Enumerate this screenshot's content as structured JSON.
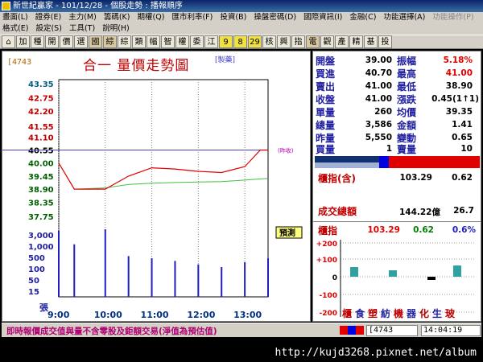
{
  "window": {
    "title": "新世紀贏家 - 101/12/28 - 個股走勢 : 播報順序"
  },
  "menu": {
    "row1": [
      "畫面(L)",
      "證券(E)",
      "主力(M)",
      "籌碼(K)",
      "期權(Q)",
      "匯市利率(F)",
      "投資(B)",
      "操盤密碼(D)",
      "國際資訊(I)",
      "金融(C)",
      "功能選擇(A)",
      "功能操作(P)"
    ],
    "row2": [
      "格式(E)",
      "設定(S)",
      "工具(T)",
      "說明(H)"
    ]
  },
  "toolbar": {
    "buttons": [
      "⌂",
      "加",
      "種",
      "開",
      "價",
      "選",
      "國",
      "綜",
      "綜",
      "類",
      "幅",
      "智",
      "權",
      "委",
      "江",
      "9",
      "8",
      "29",
      "核",
      "興",
      "指",
      "電",
      "觀",
      "產",
      "精",
      "基",
      "投"
    ]
  },
  "chart": {
    "stock_code": "[4743",
    "title": "合一  量價走勢圖",
    "industry": "[製藥]",
    "reference_label": "(昨收)",
    "volume_unit": "張",
    "price_axis_labels": [
      "43.35",
      "42.75",
      "42.20",
      "41.55",
      "41.10",
      "40.55",
      "40.00",
      "39.45",
      "38.90",
      "38.35",
      "37.75"
    ],
    "volume_axis_labels": [
      "3,000",
      "1,000",
      "500",
      "100",
      "50",
      "15"
    ],
    "time_labels": [
      "9:00",
      "10:00",
      "11:00",
      "12:00",
      "13:00"
    ],
    "trial_label": "預測"
  },
  "chart_data": {
    "type": "line",
    "title": "合一  量價走勢圖",
    "xlabel": "",
    "ylabel": "",
    "x": [
      "9:00",
      "9:20",
      "10:00",
      "10:30",
      "11:00",
      "11:30",
      "12:00",
      "12:30",
      "13:00",
      "13:20",
      "13:30"
    ],
    "series": [
      {
        "name": "price",
        "values": [
          40.0,
          38.9,
          38.9,
          39.45,
          39.8,
          39.75,
          39.65,
          39.6,
          39.85,
          40.55,
          40.55
        ]
      },
      {
        "name": "average",
        "values": [
          null,
          38.9,
          38.95,
          39.1,
          39.15,
          39.18,
          39.2,
          39.22,
          39.28,
          39.33,
          39.35
        ]
      }
    ],
    "reference_price": 40.55,
    "ylim": [
      37.75,
      43.35
    ],
    "volume_bars": [
      {
        "time": "9:00",
        "volume": 2500
      },
      {
        "time": "9:20",
        "volume": 800
      },
      {
        "time": "10:00",
        "volume": 2800
      },
      {
        "time": "10:30",
        "volume": 300
      },
      {
        "time": "11:00",
        "volume": 250
      },
      {
        "time": "11:30",
        "volume": 200
      },
      {
        "time": "12:00",
        "volume": 150
      },
      {
        "time": "12:30",
        "volume": 120
      },
      {
        "time": "13:00",
        "volume": 180
      },
      {
        "time": "13:30",
        "volume": 250
      }
    ]
  },
  "quote": {
    "open_label": "開盤",
    "open": "39.00",
    "amp_label": "振幅",
    "amp": "5.18%",
    "bid_label": "買進",
    "bid": "40.70",
    "high_label": "最高",
    "high": "41.00",
    "ask_label": "賣出",
    "ask": "41.00",
    "low_label": "最低",
    "low": "38.90",
    "close_label": "收盤",
    "close": "41.00",
    "chg_label": "漲跌",
    "chg": "0.45(1↑1)",
    "vol_label": "單量",
    "vol": "260",
    "avg_label": "均價",
    "avg": "39.35",
    "total_label": "總量",
    "total": "3,586",
    "amount_label": "金額",
    "amount": "1.41",
    "prev_label": "昨量",
    "prev": "5,550",
    "change_label": "變動",
    "change": "0.65",
    "buyq_label": "買量",
    "buyq": "1",
    "sellq_label": "賣量",
    "sellq": "10",
    "index_label": "櫃指(含)",
    "index_val": "103.29",
    "index_chg": "0.62",
    "turnover_label": "成交總額",
    "turnover_val": "144.22億",
    "turnover_chg": "26.7",
    "otc_label": "櫃指",
    "otc_val": "103.29",
    "otc_chg": "0.62",
    "otc_pct": "0.6%",
    "sector_axis": [
      "+200",
      "+100",
      "0",
      "-100",
      "-200"
    ],
    "sectors": [
      "櫃",
      "食",
      "塑",
      "紡",
      "機",
      "器",
      "化",
      "生",
      "玻"
    ]
  },
  "status": {
    "message": "即時報價成交值與量不含零股及鉅額交易(淨值為預估值)",
    "code": "[4743",
    "time": "14:04:19"
  },
  "watermark": {
    "url": "http://kujd3268.pixnet.net/album"
  }
}
